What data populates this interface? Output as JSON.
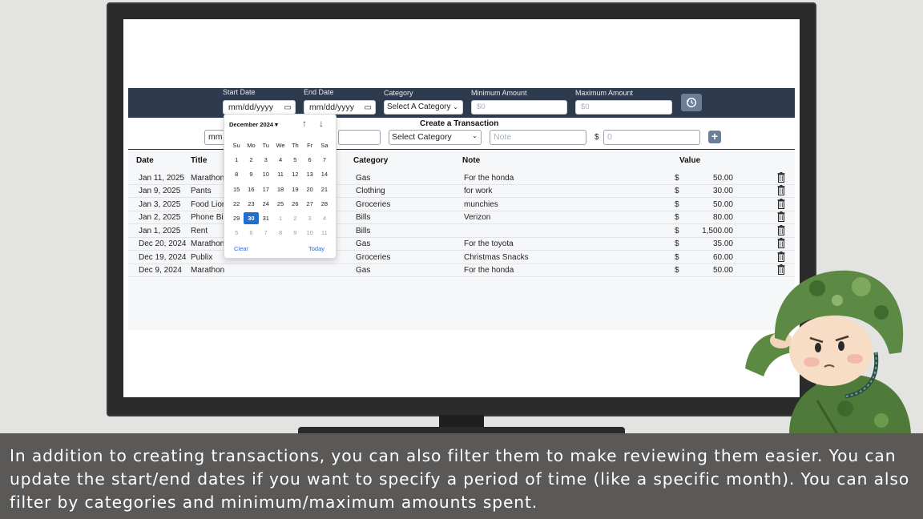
{
  "filter": {
    "start_label": "Start Date",
    "start_value": "mm/dd/yyyy",
    "end_label": "End Date",
    "end_value": "mm/dd/yyyy",
    "category_label": "Category",
    "category_value": "Select A Category",
    "min_label": "Minimum Amount",
    "min_placeholder": "$0",
    "max_label": "Maximum Amount",
    "max_placeholder": "$0",
    "reset_icon": "history-icon"
  },
  "create": {
    "title": "Create a Transaction",
    "date_value": "mm",
    "category_value": "Select Category",
    "note_placeholder": "Note",
    "currency": "$",
    "amount_placeholder": "0",
    "add_icon": "plus-icon"
  },
  "table": {
    "headers": {
      "date": "Date",
      "title": "Title",
      "category": "Category",
      "note": "Note",
      "value": "Value"
    },
    "rows": [
      {
        "date": "Jan 11, 2025",
        "title": "Marathon",
        "category": "Gas",
        "note": "For the honda",
        "currency": "$",
        "value": "50.00"
      },
      {
        "date": "Jan 9, 2025",
        "title": "Pants",
        "category": "Clothing",
        "note": "for work",
        "currency": "$",
        "value": "30.00"
      },
      {
        "date": "Jan 3, 2025",
        "title": "Food Lion",
        "category": "Groceries",
        "note": "munchies",
        "currency": "$",
        "value": "50.00"
      },
      {
        "date": "Jan 2, 2025",
        "title": "Phone Bill",
        "category": "Bills",
        "note": "Verizon",
        "currency": "$",
        "value": "80.00"
      },
      {
        "date": "Jan 1, 2025",
        "title": "Rent",
        "category": "Bills",
        "note": "",
        "currency": "$",
        "value": "1,500.00"
      },
      {
        "date": "Dec 20, 2024",
        "title": "Marathon",
        "category": "Gas",
        "note": "For the toyota",
        "currency": "$",
        "value": "35.00"
      },
      {
        "date": "Dec 19, 2024",
        "title": "Publix",
        "category": "Groceries",
        "note": "Christmas Snacks",
        "currency": "$",
        "value": "60.00"
      },
      {
        "date": "Dec 9, 2024",
        "title": "Marathon",
        "category": "Gas",
        "note": "For the honda",
        "currency": "$",
        "value": "50.00"
      }
    ]
  },
  "datepicker": {
    "month": "December 2024 ▾",
    "nav_up": "↑",
    "nav_down": "↓",
    "weekdays": [
      "Su",
      "Mo",
      "Tu",
      "We",
      "Th",
      "Fr",
      "Sa"
    ],
    "weeks": [
      [
        "1",
        "2",
        "3",
        "4",
        "5",
        "6",
        "7"
      ],
      [
        "8",
        "9",
        "10",
        "11",
        "12",
        "13",
        "14"
      ],
      [
        "15",
        "16",
        "17",
        "18",
        "19",
        "20",
        "21"
      ],
      [
        "22",
        "23",
        "24",
        "25",
        "26",
        "27",
        "28"
      ],
      [
        "29",
        "30",
        "31",
        "1",
        "2",
        "3",
        "4"
      ],
      [
        "5",
        "6",
        "7",
        "8",
        "9",
        "10",
        "11"
      ]
    ],
    "selected_day": "30",
    "clear": "Clear",
    "today": "Today"
  },
  "caption": "In addition to creating transactions, you can also filter them to make reviewing them easier. You can update the start/end dates if you want to specify a period of time (like a specific month). You can also filter by categories and minimum/maximum amounts spent.",
  "colors": {
    "header_bar": "#2e3b4e",
    "selected_day": "#1f6fd1",
    "caption_bg": "#5a5958"
  }
}
